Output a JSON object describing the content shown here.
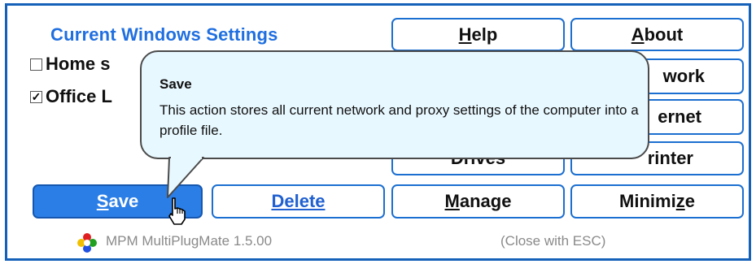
{
  "header": {
    "title": "Current Windows Settings"
  },
  "profiles": [
    {
      "label": "Home s",
      "checked": false
    },
    {
      "label": "Office L",
      "checked": true
    }
  ],
  "buttons": {
    "help": {
      "mn": "H",
      "rest": "elp"
    },
    "about": {
      "mn": "A",
      "rest": "bout"
    },
    "network": "work",
    "internet": "ernet",
    "drives": "Drives",
    "printer": "rinter",
    "save": {
      "mn": "S",
      "rest": "ave"
    },
    "delete": {
      "mn": "D",
      "rest": "elete"
    },
    "manage": {
      "mn": "M",
      "rest": "anage"
    },
    "minimize": {
      "pre": "Minimi",
      "mn": "z",
      "rest": "e"
    }
  },
  "status": {
    "app_name": "MPM MultiPlugMate 1.5.00",
    "hint": "(Close with ESC)"
  },
  "tooltip": {
    "title": "Save",
    "body": "This action stores all current network and proxy settings of the computer into a profile file."
  },
  "colors": {
    "accent": "#1f6fe0",
    "primary_button": "#2b7ee6",
    "tooltip_bg": "#e8f8ff"
  }
}
